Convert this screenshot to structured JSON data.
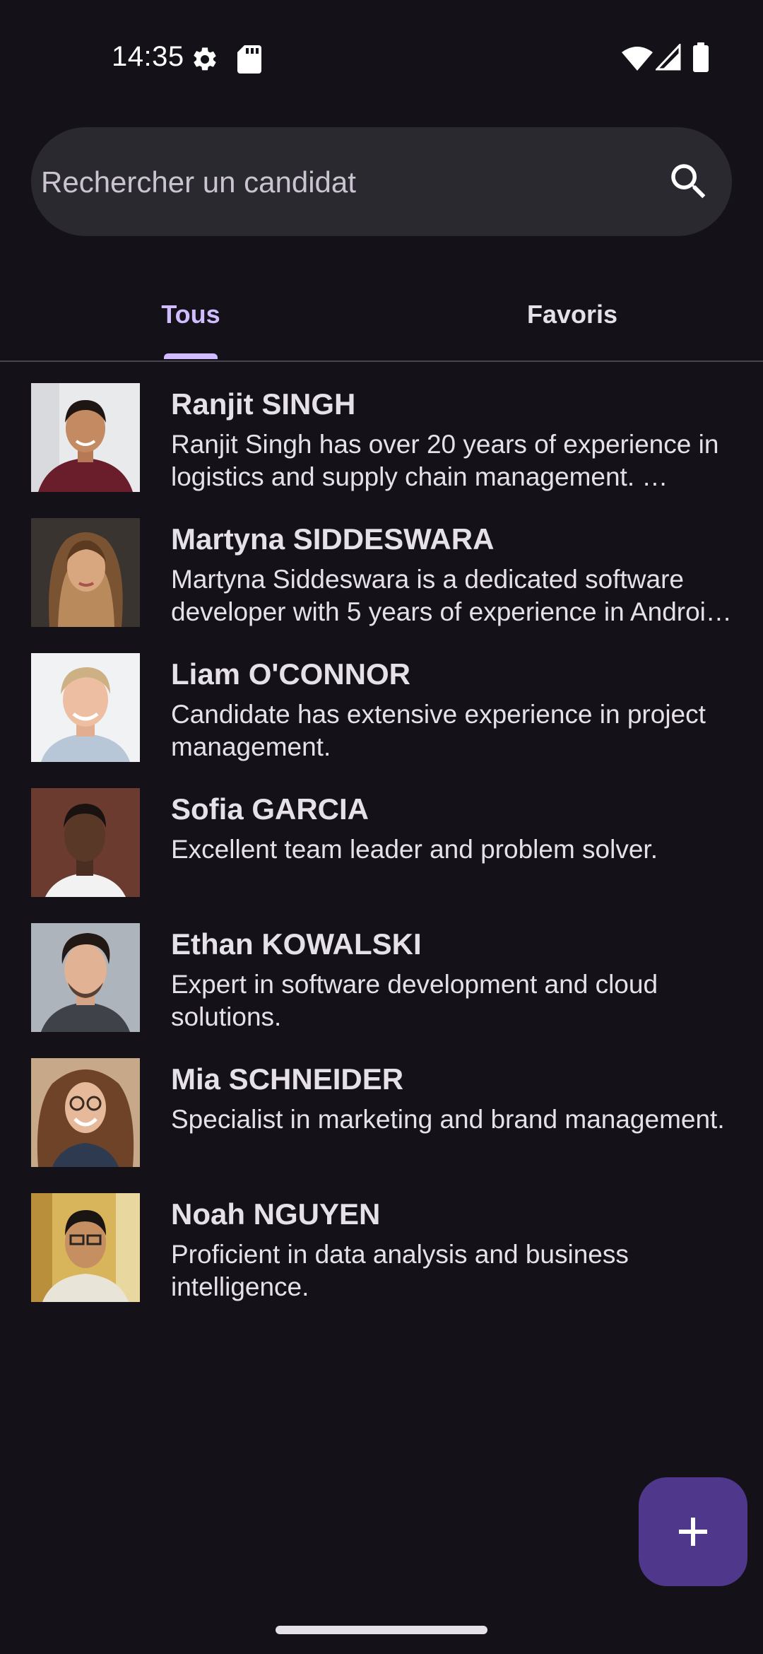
{
  "status_bar": {
    "time": "14:35",
    "icons": [
      "gear-icon",
      "sd-card-icon",
      "wifi-icon",
      "signal-icon",
      "battery-icon"
    ]
  },
  "search": {
    "placeholder": "Rechercher un candidat",
    "icon": "search-icon"
  },
  "tabs": [
    {
      "label": "Tous",
      "selected": true
    },
    {
      "label": "Favoris",
      "selected": false
    }
  ],
  "candidates": [
    {
      "name": "Ranjit SINGH",
      "description": "Ranjit Singh has over 20 years of experience in logistics and supply chain management. …"
    },
    {
      "name": "Martyna SIDDESWARA",
      "description": "Martyna Siddeswara is a dedicated software developer with 5 years of experience in Androi…"
    },
    {
      "name": "Liam O'CONNOR",
      "description": "Candidate has extensive experience in project management."
    },
    {
      "name": "Sofia GARCIA",
      "description": "Excellent team leader and problem solver."
    },
    {
      "name": "Ethan KOWALSKI",
      "description": "Expert in software development and cloud solutions."
    },
    {
      "name": "Mia SCHNEIDER",
      "description": "Specialist in marketing and brand management."
    },
    {
      "name": "Noah NGUYEN",
      "description": "Proficient in data analysis and business intelligence."
    }
  ],
  "fab": {
    "icon": "plus-icon"
  },
  "colors": {
    "background": "#141218",
    "surface": "#2B2930",
    "accent": "#D0BCFF",
    "fab": "#4F378B",
    "text": "#E6E0E9"
  }
}
